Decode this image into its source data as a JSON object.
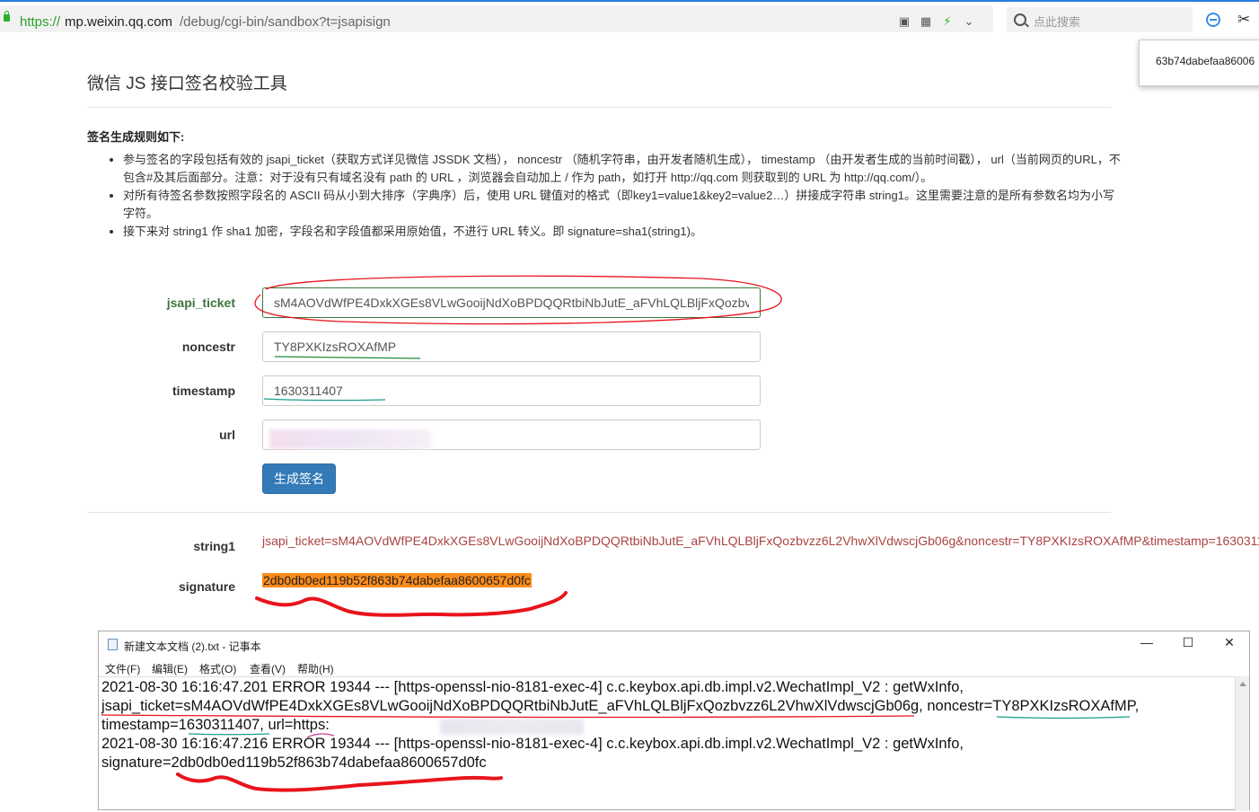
{
  "browser": {
    "url_protocol": "https://",
    "url_host": "mp.weixin.qq.com",
    "url_path": "/debug/cgi-bin/sandbox?t=jsapisign",
    "search_placeholder": "点此搜索",
    "popup_text": "63b74dabefaa86006"
  },
  "page": {
    "title": "微信 JS 接口签名校验工具",
    "rules_heading": "签名生成规则如下:",
    "rules": [
      "参与签名的字段包括有效的 jsapi_ticket（获取方式详见微信 JSSDK 文档）， noncestr （随机字符串，由开发者随机生成）， timestamp （由开发者生成的当前时间戳）， url（当前网页的URL，不包含#及其后面部分。注意：对于没有只有域名没有 path 的 URL ，浏览器会自动加上 / 作为 path，如打开 http://qq.com 则获取到的 URL 为 http://qq.com/）。",
      "对所有待签名参数按照字段名的 ASCII 码从小到大排序（字典序）后，使用 URL 键值对的格式（即key1=value1&key2=value2…）拼接成字符串 string1。这里需要注意的是所有参数名均为小写字符。",
      "接下来对 string1 作 sha1 加密，字段名和字段值都采用原始值，不进行 URL 转义。即 signature=sha1(string1)。"
    ],
    "form": {
      "jsapi_ticket_label": "jsapi_ticket",
      "jsapi_ticket_value": "sM4AOVdWfPE4DxkXGEs8VLwGooijNdXoBPDQQRtbiNbJutE_aFVhLQLBljFxQozbvzz6L2VhwXlVdwscjGb06g",
      "noncestr_label": "noncestr",
      "noncestr_value": "TY8PXKIzsROXAfMP",
      "timestamp_label": "timestamp",
      "timestamp_value": "1630311407",
      "url_label": "url",
      "url_value": "",
      "generate_button": "生成签名"
    },
    "result": {
      "string1_label": "string1",
      "string1_value": "jsapi_ticket=sM4AOVdWfPE4DxkXGEs8VLwGooijNdXoBPDQQRtbiNbJutE_aFVhLQLBljFxQozbvzz6L2VhwXlVdwscjGb06g&noncestr=TY8PXKIzsROXAfMP&timestamp=1630311",
      "signature_label": "signature",
      "signature_value": "2db0db0ed119b52f863b74dabefaa8600657d0fc"
    }
  },
  "notepad": {
    "title": "新建文本文档 (2).txt - 记事本",
    "menu": [
      "文件(F)",
      "编辑(E)",
      "格式(O)",
      "查看(V)",
      "帮助(H)"
    ],
    "lines": [
      "2021-08-30 16:16:47.201 ERROR 19344 --- [https-openssl-nio-8181-exec-4] c.c.keybox.api.db.impl.v2.WechatImpl_V2  : getWxInfo,",
      "jsapi_ticket=sM4AOVdWfPE4DxkXGEs8VLwGooijNdXoBPDQQRtbiNbJutE_aFVhLQLBljFxQozbvzz6L2VhwXlVdwscjGb06g, noncestr=TY8PXKIzsROXAfMP,",
      "timestamp=1630311407, url=https:",
      "2021-08-30 16:16:47.216 ERROR 19344 --- [https-openssl-nio-8181-exec-4] c.c.keybox.api.db.impl.v2.WechatImpl_V2  : getWxInfo,",
      "signature=2db0db0ed119b52f863b74dabefaa8600657d0fc"
    ]
  },
  "colors": {
    "accent_blue": "#337ab7",
    "success_green": "#3c763d",
    "result_red": "#a94442",
    "signature_highlight": "#ff8c1a",
    "annotation_red": "#e8141c"
  }
}
